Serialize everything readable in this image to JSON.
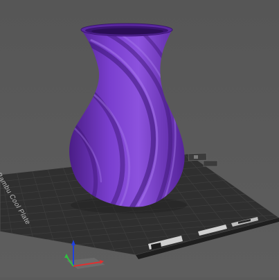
{
  "scene": {
    "model_name": "twisted vase",
    "model_color": "#6a2fb3",
    "plate_color": "#2f2f2f",
    "background_color": "#5b5b5b"
  },
  "plate": {
    "brand_label": "Bambu Cool Plate"
  },
  "axes": {
    "x_color": "#e03030",
    "y_color": "#30c040",
    "z_color": "#2040e0"
  }
}
